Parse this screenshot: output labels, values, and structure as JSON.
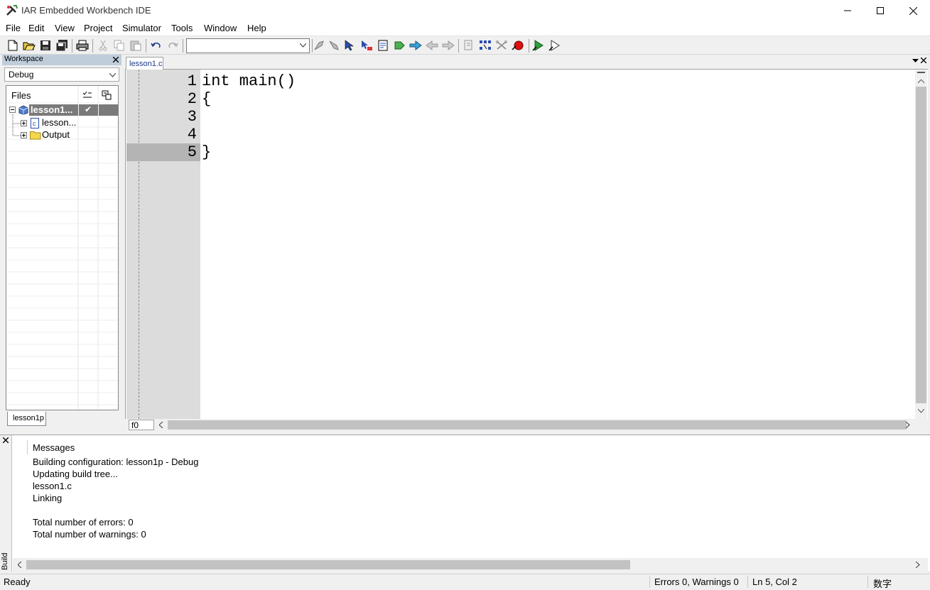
{
  "app": {
    "title": "IAR Embedded Workbench IDE"
  },
  "menu": [
    "File",
    "Edit",
    "View",
    "Project",
    "Simulator",
    "Tools",
    "Window",
    "Help"
  ],
  "workspace": {
    "header": "Workspace",
    "config": "Debug",
    "columns": {
      "files": "Files"
    },
    "tree": [
      {
        "label": "lesson1...",
        "checked": "✔",
        "level": 0
      },
      {
        "label": "lesson...",
        "level": 1
      },
      {
        "label": "Output",
        "level": 1
      }
    ],
    "tab": "lesson1p"
  },
  "editor": {
    "tab": "lesson1.c",
    "lines": [
      {
        "num": "1",
        "text": "int main()"
      },
      {
        "num": "2",
        "text": "{"
      },
      {
        "num": "3",
        "text": ""
      },
      {
        "num": "4",
        "text": ""
      },
      {
        "num": "5",
        "text": "}"
      }
    ],
    "bottom_label": "f0"
  },
  "build": {
    "side_label": "Build",
    "header": "Messages",
    "messages": [
      "Building configuration: lesson1p - Debug",
      "Updating build tree...",
      "lesson1.c",
      "Linking",
      "",
      "Total number of errors: 0",
      "Total number of warnings: 0"
    ]
  },
  "status": {
    "left": "Ready",
    "errors": "Errors 0, Warnings 0",
    "position": "Ln 5, Col 2",
    "ime": "数字"
  },
  "colors": {
    "panel_header": "#bfcddb",
    "selection": "#7a7a7a",
    "gutter": "#dcdcdc"
  }
}
